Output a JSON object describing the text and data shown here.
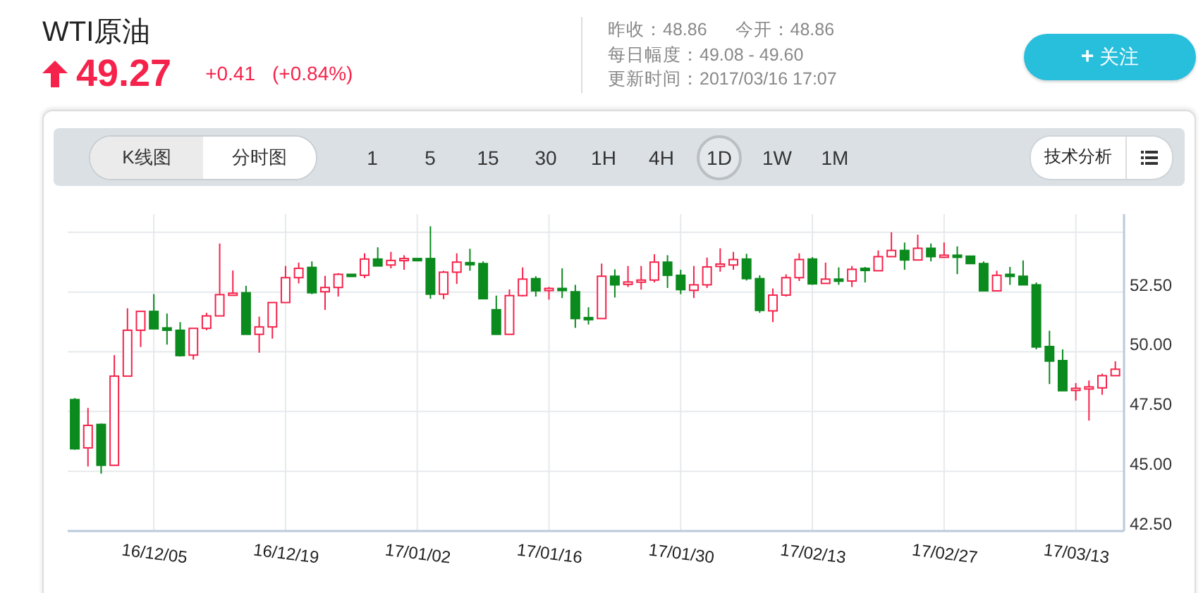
{
  "header": {
    "title": "WTI原油",
    "price": "49.27",
    "rising": true,
    "change": "+0.41",
    "change_percent": "(+0.84%)",
    "info": [
      "昨收：48.86",
      "今开：48.86",
      "每日幅度：49.08 - 49.60",
      "更新时间：2017/03/16 17:07"
    ],
    "follow_button": {
      "icon": "+",
      "label": "关注"
    }
  },
  "toolbar": {
    "chart_types": [
      {
        "label": "K线图",
        "selected": true
      },
      {
        "label": "分时图",
        "selected": false
      }
    ],
    "intervals": [
      {
        "label": "1",
        "selected": false
      },
      {
        "label": "5",
        "selected": false
      },
      {
        "label": "15",
        "selected": false
      },
      {
        "label": "30",
        "selected": false
      },
      {
        "label": "1H",
        "selected": false
      },
      {
        "label": "4H",
        "selected": false
      },
      {
        "label": "1D",
        "selected": true
      },
      {
        "label": "1W",
        "selected": false
      },
      {
        "label": "1M",
        "selected": false
      }
    ],
    "analysis_button": "技术分析"
  },
  "chart": {
    "chart_data": {
      "type": "candlestick",
      "grid": true,
      "ylim": [
        42.5,
        55.76
      ],
      "yticks": [
        {
          "value": 42.5,
          "label": "42.50"
        },
        {
          "value": 45,
          "label": "45.00"
        },
        {
          "value": 47.5,
          "label": "47.50"
        },
        {
          "value": 50,
          "label": "50.00"
        },
        {
          "value": 52.5,
          "label": "52.50"
        }
      ],
      "categories": [
        null,
        null,
        null,
        null,
        null,
        null,
        "16/12/05",
        null,
        null,
        null,
        null,
        null,
        null,
        null,
        null,
        null,
        "16/12/19",
        null,
        null,
        null,
        null,
        null,
        null,
        null,
        null,
        null,
        "17/01/02",
        null,
        null,
        null,
        null,
        null,
        null,
        null,
        null,
        null,
        "17/01/16",
        null,
        null,
        null,
        null,
        null,
        null,
        null,
        null,
        null,
        "17/01/30",
        null,
        null,
        null,
        null,
        null,
        null,
        null,
        null,
        null,
        "17/02/13",
        null,
        null,
        null,
        null,
        null,
        null,
        null,
        null,
        null,
        "17/02/27",
        null,
        null,
        null,
        null,
        null,
        null,
        null,
        null,
        null,
        "17/03/13",
        null,
        null,
        null
      ],
      "ohlc": [
        [
          48.0,
          48.06,
          45.9,
          45.94
        ],
        [
          45.98,
          47.65,
          45.2,
          46.92
        ],
        [
          46.96,
          47.0,
          44.9,
          45.25
        ],
        [
          45.25,
          49.86,
          45.25,
          48.98
        ],
        [
          48.98,
          51.82,
          48.98,
          50.9
        ],
        [
          50.9,
          51.69,
          50.2,
          51.69
        ],
        [
          51.69,
          52.41,
          50.96,
          50.96
        ],
        [
          51.0,
          51.6,
          50.3,
          50.9
        ],
        [
          50.9,
          51.24,
          49.8,
          49.84
        ],
        [
          49.86,
          50.98,
          49.67,
          50.98
        ],
        [
          50.98,
          51.63,
          50.9,
          51.5
        ],
        [
          51.5,
          54.53,
          51.5,
          52.39
        ],
        [
          52.37,
          53.4,
          52.37,
          52.45
        ],
        [
          52.47,
          52.76,
          50.73,
          50.73
        ],
        [
          50.73,
          51.47,
          49.96,
          51.04
        ],
        [
          51.04,
          52.06,
          50.55,
          52.06
        ],
        [
          52.06,
          53.59,
          52.06,
          53.1
        ],
        [
          53.1,
          53.73,
          52.86,
          53.49
        ],
        [
          53.53,
          53.78,
          52.41,
          52.47
        ],
        [
          52.51,
          53.18,
          51.75,
          52.69
        ],
        [
          52.69,
          53.29,
          52.31,
          53.24
        ],
        [
          53.24,
          53.24,
          53.2,
          53.2
        ],
        [
          53.2,
          54.12,
          53.08,
          53.88
        ],
        [
          53.88,
          54.37,
          53.59,
          53.59
        ],
        [
          53.63,
          54.18,
          53.49,
          53.82
        ],
        [
          53.82,
          54.04,
          53.43,
          53.9
        ],
        [
          53.9,
          53.9,
          53.86,
          53.86
        ],
        [
          53.9,
          55.25,
          52.22,
          52.41
        ],
        [
          52.41,
          53.39,
          52.2,
          53.33
        ],
        [
          53.33,
          54.12,
          52.84,
          53.75
        ],
        [
          53.73,
          54.31,
          53.39,
          53.65
        ],
        [
          53.69,
          53.78,
          52.2,
          52.22
        ],
        [
          51.76,
          52.35,
          50.73,
          50.73
        ],
        [
          50.73,
          52.61,
          50.73,
          52.35
        ],
        [
          52.35,
          53.53,
          52.31,
          53.04
        ],
        [
          53.06,
          53.16,
          52.31,
          52.55
        ],
        [
          52.57,
          52.71,
          52.18,
          52.65
        ],
        [
          52.65,
          53.49,
          52.25,
          52.57
        ],
        [
          52.51,
          52.8,
          51.0,
          51.39
        ],
        [
          51.43,
          51.86,
          51.14,
          51.35
        ],
        [
          51.39,
          53.69,
          51.39,
          53.16
        ],
        [
          53.16,
          53.45,
          52.27,
          52.8
        ],
        [
          52.82,
          53.59,
          52.71,
          52.92
        ],
        [
          52.94,
          53.59,
          52.6,
          53.0
        ],
        [
          53.0,
          54.08,
          52.9,
          53.75
        ],
        [
          53.75,
          54.04,
          52.67,
          53.2
        ],
        [
          53.2,
          53.43,
          52.41,
          52.6
        ],
        [
          52.57,
          53.59,
          52.25,
          52.8
        ],
        [
          52.8,
          53.94,
          52.67,
          53.55
        ],
        [
          53.57,
          54.33,
          53.35,
          53.67
        ],
        [
          53.63,
          54.18,
          53.43,
          53.86
        ],
        [
          53.88,
          54.1,
          52.98,
          53.06
        ],
        [
          53.06,
          53.2,
          51.63,
          51.73
        ],
        [
          51.71,
          52.65,
          51.24,
          52.37
        ],
        [
          52.37,
          53.24,
          52.31,
          53.1
        ],
        [
          53.1,
          54.12,
          52.96,
          53.86
        ],
        [
          53.88,
          53.96,
          52.8,
          52.84
        ],
        [
          52.86,
          53.73,
          52.86,
          53.04
        ],
        [
          53.04,
          53.53,
          52.8,
          52.96
        ],
        [
          52.96,
          53.59,
          52.71,
          53.45
        ],
        [
          53.49,
          53.55,
          52.9,
          53.41
        ],
        [
          53.39,
          54.24,
          53.39,
          53.98
        ],
        [
          53.98,
          55.0,
          53.98,
          54.24
        ],
        [
          54.24,
          54.57,
          53.43,
          53.84
        ],
        [
          53.84,
          54.9,
          53.84,
          54.33
        ],
        [
          54.33,
          54.53,
          53.78,
          53.98
        ],
        [
          53.98,
          54.57,
          53.98,
          54.04
        ],
        [
          54.04,
          54.41,
          53.25,
          53.96
        ],
        [
          54.0,
          54.02,
          53.69,
          53.69
        ],
        [
          53.69,
          53.78,
          52.55,
          52.55
        ],
        [
          52.55,
          53.39,
          52.55,
          53.2
        ],
        [
          53.24,
          53.55,
          52.8,
          53.16
        ],
        [
          53.16,
          53.82,
          52.8,
          52.8
        ],
        [
          52.8,
          52.9,
          50.1,
          50.2
        ],
        [
          50.22,
          50.88,
          48.65,
          49.61
        ],
        [
          49.63,
          50.1,
          48.37,
          48.37
        ],
        [
          48.41,
          48.69,
          47.96,
          48.47
        ],
        [
          48.47,
          48.8,
          47.12,
          48.53
        ],
        [
          48.49,
          49.08,
          48.2,
          49.0
        ],
        [
          49.0,
          49.6,
          49.0,
          49.27
        ]
      ]
    }
  }
}
